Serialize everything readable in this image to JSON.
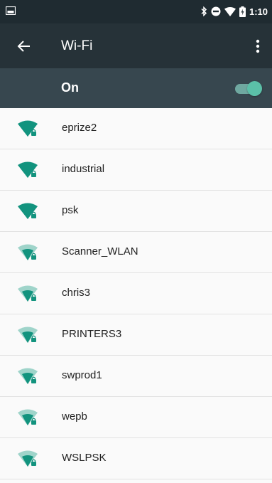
{
  "status_bar": {
    "time": "1:10",
    "icons": [
      "image-icon",
      "bluetooth-icon",
      "do-not-disturb-icon",
      "wifi-icon",
      "battery-icon"
    ]
  },
  "app_bar": {
    "title": "Wi-Fi",
    "back_icon": "arrow-back-icon",
    "menu_icon": "more-vertical-icon"
  },
  "toggle_bar": {
    "label": "On",
    "state": "on"
  },
  "colors": {
    "status_bar": "#1f2b31",
    "app_bar": "#263238",
    "toggle_bar": "#37474f",
    "accent": "#12937e",
    "accent_light": "#9fd4ca",
    "toggle_thumb": "#5bc0a8"
  },
  "networks": [
    {
      "name": "eprize2",
      "signal": "strong",
      "secured": true
    },
    {
      "name": "industrial",
      "signal": "strong",
      "secured": true
    },
    {
      "name": "psk",
      "signal": "strong",
      "secured": true
    },
    {
      "name": "Scanner_WLAN",
      "signal": "medium",
      "secured": true
    },
    {
      "name": "chris3",
      "signal": "medium",
      "secured": true
    },
    {
      "name": "PRINTERS3",
      "signal": "medium",
      "secured": true
    },
    {
      "name": "swprod1",
      "signal": "medium",
      "secured": true
    },
    {
      "name": "wepb",
      "signal": "medium",
      "secured": true
    },
    {
      "name": "WSLPSK",
      "signal": "medium",
      "secured": true
    }
  ]
}
